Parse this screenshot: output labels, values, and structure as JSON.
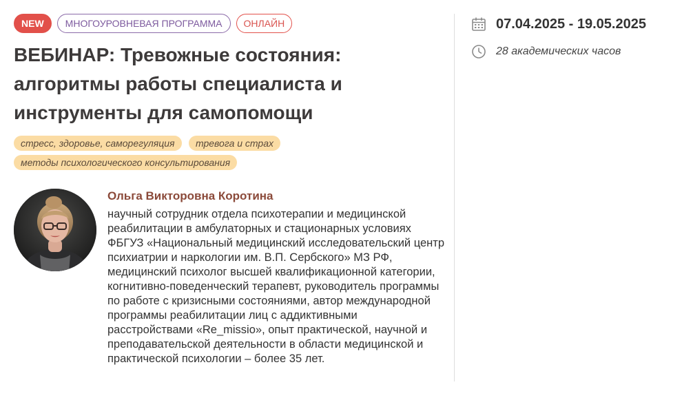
{
  "badges": {
    "new": "NEW",
    "program": "МНОГОУРОВНЕВАЯ ПРОГРАММА",
    "format": "ОНЛАЙН"
  },
  "course": {
    "title": "ВЕБИНАР: Тревожные состояния: алгоритмы работы специалиста и инструменты для самопомощи",
    "dates": "07.04.2025 - 19.05.2025",
    "hours": "28 академических часов"
  },
  "tags": [
    "стресс, здоровье, саморегуляция",
    "тревога и страх",
    "методы психологического консультирования"
  ],
  "author": {
    "name": "Ольга Викторовна Коротина",
    "bio": "научный сотрудник отдела психотерапии и медицинской реабилитации в амбулаторных и стационарных условиях ФБГУЗ «Национальный медицинский исследовательский центр психиатрии и наркологии им. В.П. Сербского» МЗ РФ, медицинский психолог высшей квалификационной категории, когнитивно-поведенческий терапевт, руководитель программы по работе с кризисными состояниями, автор международной программы реабилитации лиц с аддиктивными расстройствами «Re_missio», опыт практической, научной и преподавательской деятельности в области медицинской и практической психологии – более 35 лет."
  },
  "icons": {
    "calendar": "calendar-icon",
    "clock": "clock-icon"
  },
  "colors": {
    "accent_red": "#e2504a",
    "accent_purple": "#7d5a9e",
    "tag_bg": "#fbdca4",
    "author_name": "#8b4a3a"
  }
}
